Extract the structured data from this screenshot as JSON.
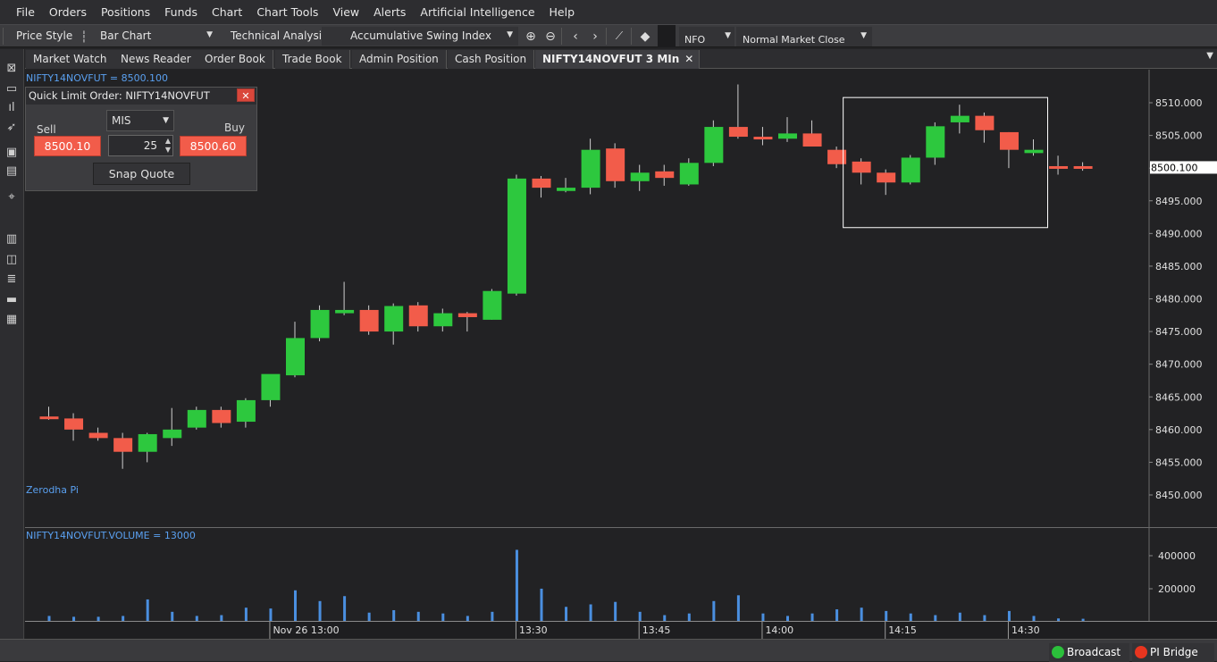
{
  "menu": [
    "File",
    "Orders",
    "Positions",
    "Funds",
    "Chart",
    "Chart Tools",
    "View",
    "Alerts",
    "Artificial Intelligence",
    "Help"
  ],
  "toolbar": {
    "price_style_label": "Price Style",
    "price_style_value": "Bar Chart",
    "technical_analysis_label": "Technical Analysis",
    "indicator_value": "Accumulative Swing Index",
    "exchange_value": "NFO",
    "market_type_value": "Normal Market Close"
  },
  "tabs": [
    "Market Watch",
    "News Reader",
    "Order Book",
    "Trade Book",
    "Admin Position",
    "Cash Position",
    "NIFTY14NOVFUT 3 MIn"
  ],
  "active_tab_index": 6,
  "chart": {
    "price_label": "NIFTY14NOVFUT = 8500.100",
    "watermark": "Zerodha Pi",
    "volume_label": "NIFTY14NOVFUT.VOLUME = 13000",
    "current_price": "8500.100"
  },
  "quick_order": {
    "title": "Quick Limit Order: NIFTY14NOVFUT",
    "sell_label": "Sell",
    "buy_label": "Buy",
    "product": "MIS",
    "quantity": "25",
    "sell_price": "8500.10",
    "buy_price": "8500.60",
    "snap_label": "Snap Quote"
  },
  "status": {
    "broadcast_label": "Broadcast",
    "broadcast_color": "#2bc03b",
    "bridge_label": "PI Bridge",
    "bridge_color": "#e8351f"
  },
  "colors": {
    "up": "#2dc83e",
    "down": "#f25c4a",
    "volume": "#4a8fe0",
    "accent_label": "#5aa0f0"
  },
  "chart_data": {
    "type": "candlestick",
    "interval": "3 Min",
    "date_label": "Nov 26",
    "price_ticks": [
      8450,
      8455,
      8460,
      8465,
      8470,
      8475,
      8480,
      8485,
      8490,
      8495,
      8500,
      8505,
      8510
    ],
    "price_tick_labels": [
      "8450.000",
      "8455.000",
      "8460.000",
      "8465.000",
      "8470.000",
      "8475.000",
      "8480.000",
      "8485.000",
      "8490.000",
      "8495.000",
      "8500.000",
      "8505.000",
      "8510.000"
    ],
    "ylim": [
      8444,
      8516
    ],
    "volume_ticks": [
      200000,
      400000
    ],
    "volume_tick_labels": [
      "200000",
      "400000"
    ],
    "x_tick_labels": [
      {
        "label": "Nov 26 13:00",
        "index": 9
      },
      {
        "label": "13:30",
        "index": 19
      },
      {
        "label": "13:45",
        "index": 24
      },
      {
        "label": "14:00",
        "index": 29
      },
      {
        "label": "14:15",
        "index": 34
      },
      {
        "label": "14:30",
        "index": 39
      }
    ],
    "candles": [
      {
        "o": 8462.0,
        "h": 8463.5,
        "l": 8461.5,
        "c": 8461.7
      },
      {
        "o": 8461.7,
        "h": 8462.5,
        "l": 8458.3,
        "c": 8460.0
      },
      {
        "o": 8459.5,
        "h": 8460.3,
        "l": 8458.3,
        "c": 8458.7
      },
      {
        "o": 8458.7,
        "h": 8459.5,
        "l": 8454.0,
        "c": 8456.6
      },
      {
        "o": 8456.6,
        "h": 8459.5,
        "l": 8455.0,
        "c": 8459.3
      },
      {
        "o": 8458.7,
        "h": 8463.3,
        "l": 8457.5,
        "c": 8460.0
      },
      {
        "o": 8460.3,
        "h": 8463.5,
        "l": 8460.0,
        "c": 8463.0
      },
      {
        "o": 8463.0,
        "h": 8463.5,
        "l": 8460.3,
        "c": 8461.0
      },
      {
        "o": 8461.2,
        "h": 8464.8,
        "l": 8460.3,
        "c": 8464.5
      },
      {
        "o": 8464.5,
        "h": 8468.0,
        "l": 8463.5,
        "c": 8468.5
      },
      {
        "o": 8468.3,
        "h": 8476.5,
        "l": 8468.0,
        "c": 8474.0
      },
      {
        "o": 8474.0,
        "h": 8479.0,
        "l": 8473.5,
        "c": 8478.3
      },
      {
        "o": 8477.8,
        "h": 8482.6,
        "l": 8477.5,
        "c": 8478.3
      },
      {
        "o": 8478.3,
        "h": 8479.0,
        "l": 8474.5,
        "c": 8475.0
      },
      {
        "o": 8475.0,
        "h": 8479.3,
        "l": 8473.0,
        "c": 8478.9
      },
      {
        "o": 8479.0,
        "h": 8479.5,
        "l": 8475.0,
        "c": 8475.8
      },
      {
        "o": 8475.8,
        "h": 8478.5,
        "l": 8475.0,
        "c": 8477.8
      },
      {
        "o": 8477.8,
        "h": 8478.0,
        "l": 8475.0,
        "c": 8477.2
      },
      {
        "o": 8476.8,
        "h": 8481.5,
        "l": 8476.8,
        "c": 8481.2
      },
      {
        "o": 8480.8,
        "h": 8499.0,
        "l": 8480.5,
        "c": 8498.4
      },
      {
        "o": 8498.4,
        "h": 8498.8,
        "l": 8495.5,
        "c": 8497.0
      },
      {
        "o": 8496.5,
        "h": 8498.5,
        "l": 8496.3,
        "c": 8497.0
      },
      {
        "o": 8497.0,
        "h": 8504.5,
        "l": 8496.0,
        "c": 8502.8
      },
      {
        "o": 8503.0,
        "h": 8503.8,
        "l": 8497.0,
        "c": 8498.0
      },
      {
        "o": 8498.0,
        "h": 8500.5,
        "l": 8496.5,
        "c": 8499.3
      },
      {
        "o": 8499.5,
        "h": 8500.5,
        "l": 8497.3,
        "c": 8498.5
      },
      {
        "o": 8497.5,
        "h": 8501.5,
        "l": 8497.3,
        "c": 8500.8
      },
      {
        "o": 8500.8,
        "h": 8507.3,
        "l": 8500.3,
        "c": 8506.3
      },
      {
        "o": 8506.3,
        "h": 8512.8,
        "l": 8504.5,
        "c": 8504.8
      },
      {
        "o": 8504.8,
        "h": 8506.3,
        "l": 8503.5,
        "c": 8504.5
      },
      {
        "o": 8504.5,
        "h": 8507.8,
        "l": 8504.0,
        "c": 8505.3
      },
      {
        "o": 8505.3,
        "h": 8507.3,
        "l": 8503.5,
        "c": 8503.3
      },
      {
        "o": 8502.8,
        "h": 8503.3,
        "l": 8500.0,
        "c": 8500.6
      },
      {
        "o": 8501.0,
        "h": 8501.5,
        "l": 8497.5,
        "c": 8499.3
      },
      {
        "o": 8499.3,
        "h": 8499.8,
        "l": 8495.9,
        "c": 8497.8
      },
      {
        "o": 8497.8,
        "h": 8502.0,
        "l": 8497.5,
        "c": 8501.6
      },
      {
        "o": 8501.6,
        "h": 8507.0,
        "l": 8500.5,
        "c": 8506.4
      },
      {
        "o": 8507.0,
        "h": 8509.7,
        "l": 8505.3,
        "c": 8508.0
      },
      {
        "o": 8508.0,
        "h": 8508.5,
        "l": 8503.9,
        "c": 8505.8
      },
      {
        "o": 8505.5,
        "h": 8505.5,
        "l": 8500.0,
        "c": 8502.8
      },
      {
        "o": 8502.3,
        "h": 8504.4,
        "l": 8501.9,
        "c": 8502.8
      },
      {
        "o": 8500.3,
        "h": 8501.9,
        "l": 8499.0,
        "c": 8500.0
      },
      {
        "o": 8500.3,
        "h": 8500.9,
        "l": 8499.6,
        "c": 8500.1
      }
    ],
    "volumes": [
      30000,
      25000,
      25000,
      30000,
      130000,
      55000,
      30000,
      35000,
      80000,
      75000,
      185000,
      120000,
      150000,
      50000,
      65000,
      55000,
      45000,
      30000,
      55000,
      430000,
      195000,
      85000,
      100000,
      115000,
      55000,
      35000,
      45000,
      120000,
      155000,
      45000,
      30000,
      45000,
      70000,
      80000,
      60000,
      45000,
      35000,
      50000,
      35000,
      60000,
      30000,
      15000,
      13000
    ],
    "selection_box": {
      "from_index": 33,
      "to_index": 40,
      "price_high": 8510.8,
      "price_low": 8490.9
    }
  }
}
